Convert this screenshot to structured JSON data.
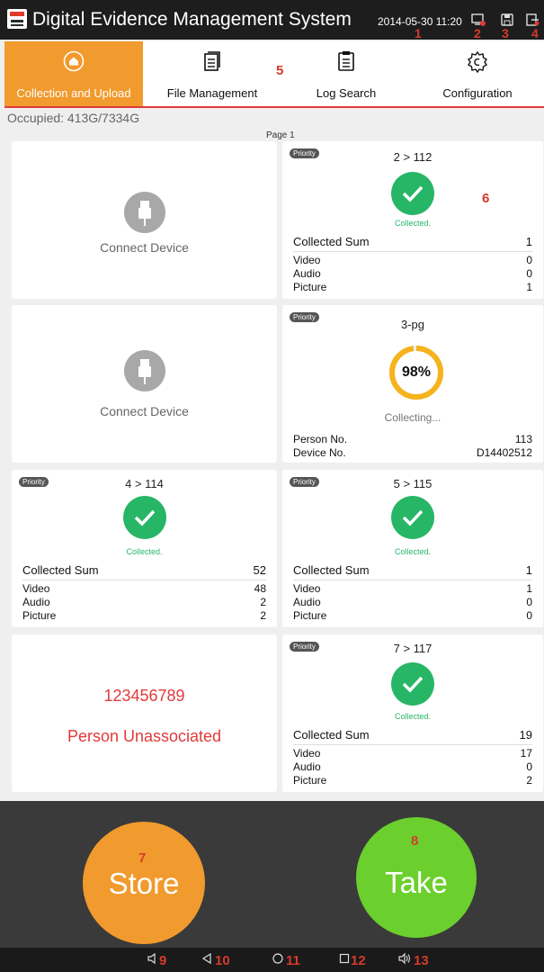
{
  "header": {
    "title": "Digital Evidence Management System",
    "datetime": "2014-05-30 11:20",
    "icons": [
      "device-status-icon",
      "save-icon",
      "exit-icon"
    ]
  },
  "callouts": [
    "1",
    "2",
    "3",
    "4",
    "5",
    "6",
    "7",
    "8",
    "9",
    "10",
    "11",
    "12",
    "13"
  ],
  "tabs": [
    {
      "label": "Collection and Upload",
      "icon": "home-icon",
      "active": true
    },
    {
      "label": "File Management",
      "icon": "document-icon",
      "active": false
    },
    {
      "label": "Log Search",
      "icon": "clipboard-icon",
      "active": false
    },
    {
      "label": "Configuration",
      "icon": "gear-icon",
      "active": false
    }
  ],
  "storage": "Occupied: 413G/7334G",
  "page_label": "Page 1",
  "slots": {
    "s1": {
      "text": "Connect Device"
    },
    "s2": {
      "priority": "Priority",
      "seq": "2 > 112",
      "status": "Collected.",
      "sum_label": "Collected Sum",
      "sum": "1",
      "video_label": "Video",
      "video": "0",
      "audio_label": "Audio",
      "audio": "0",
      "picture_label": "Picture",
      "picture": "1"
    },
    "s3": {
      "text": "Connect Device"
    },
    "s4": {
      "priority": "Priority",
      "seq": "3-pg",
      "progress": 98,
      "progress_label": "98%",
      "status": "Collecting...",
      "person_label": "Person No.",
      "person": "113",
      "device_label": "Device No.",
      "device": "D14402512"
    },
    "s5": {
      "priority": "Priority",
      "seq": "4 > 114",
      "status": "Collected.",
      "sum_label": "Collected Sum",
      "sum": "52",
      "video_label": "Video",
      "video": "48",
      "audio_label": "Audio",
      "audio": "2",
      "picture_label": "Picture",
      "picture": "2"
    },
    "s6": {
      "priority": "Priority",
      "seq": "5 > 115",
      "status": "Collected.",
      "sum_label": "Collected Sum",
      "sum": "1",
      "video_label": "Video",
      "video": "1",
      "audio_label": "Audio",
      "audio": "0",
      "picture_label": "Picture",
      "picture": "0"
    },
    "s7": {
      "number": "123456789",
      "status": "Person Unassociated"
    },
    "s8": {
      "priority": "Priority",
      "seq": "7 > 117",
      "status": "Collected.",
      "sum_label": "Collected Sum",
      "sum": "19",
      "video_label": "Video",
      "video": "17",
      "audio_label": "Audio",
      "audio": "0",
      "picture_label": "Picture",
      "picture": "2"
    }
  },
  "actions": {
    "store": "Store",
    "take": "Take"
  },
  "navbar": [
    "volume-down-icon",
    "back-icon",
    "home-circle-icon",
    "recents-icon",
    "volume-up-icon"
  ],
  "colors": {
    "accent": "#f19a2d",
    "success": "#27b665",
    "alert": "#e03a3a",
    "take": "#6bcf2d"
  }
}
